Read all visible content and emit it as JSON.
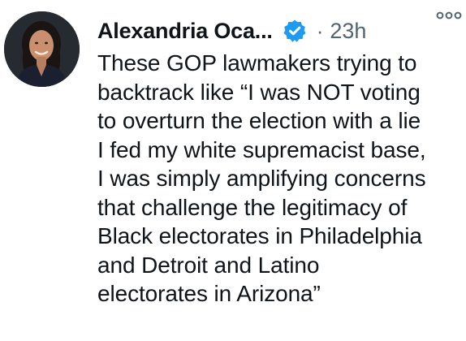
{
  "tweet": {
    "author": {
      "display_name": "Alexandria Oca...",
      "verified": true,
      "avatar_icon": "profile-photo"
    },
    "separator": "·",
    "timestamp": "23h",
    "more_icon": "more-options-icon",
    "text_lines": [
      "These GOP lawmakers trying to",
      "backtrack like “I was NOT voting",
      "to overturn the election with a lie",
      "I fed my white supremacist base,",
      "I was simply amplifying concerns",
      "that challenge the legitimacy of",
      "Black electorates in Philadelphia",
      "and Detroit and Latino",
      "electorates in Arizona”"
    ]
  },
  "colors": {
    "text": "#0f1419",
    "muted": "#536471",
    "verified_blue": "#1d9bf0",
    "background": "#ffffff"
  }
}
